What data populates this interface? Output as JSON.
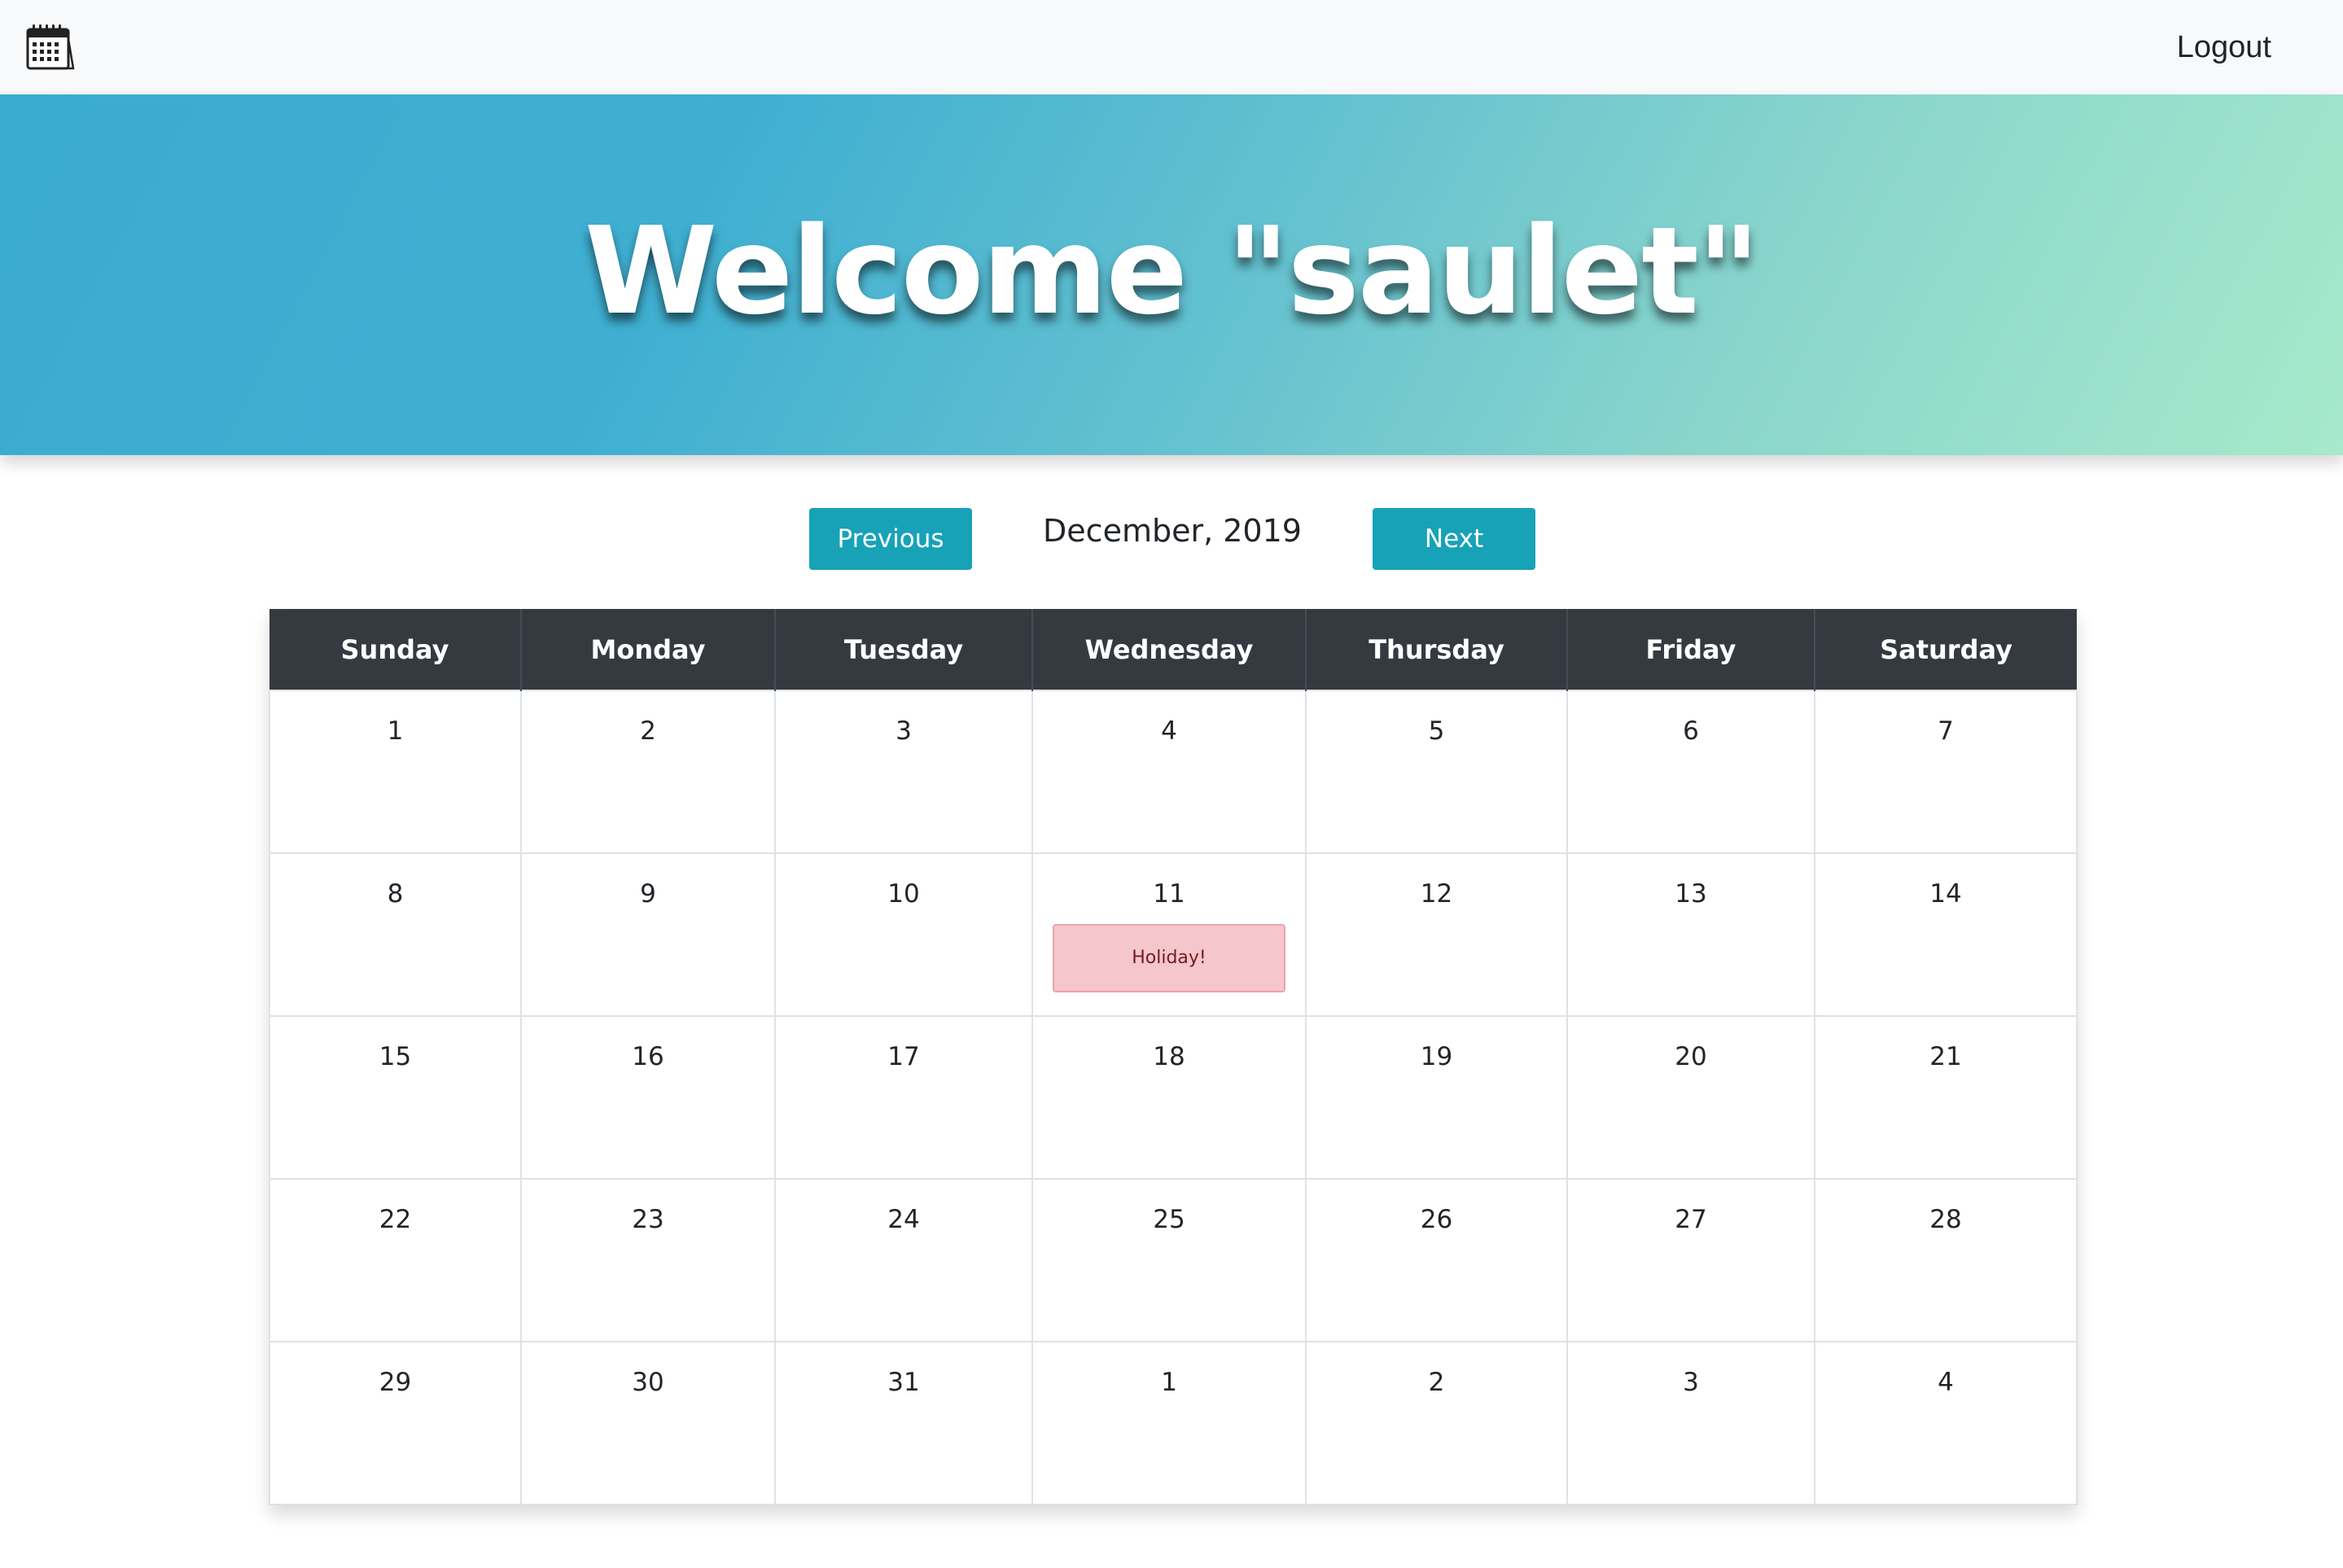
{
  "navbar": {
    "logo_icon": "calendar-icon",
    "logout_label": "Logout"
  },
  "hero": {
    "title": "Welcome \"saulet\""
  },
  "month_nav": {
    "previous_label": "Previous",
    "next_label": "Next",
    "current_month": "December, 2019"
  },
  "calendar": {
    "weekdays": [
      "Sunday",
      "Monday",
      "Tuesday",
      "Wednesday",
      "Thursday",
      "Friday",
      "Saturday"
    ],
    "weeks": [
      [
        {
          "day": "1"
        },
        {
          "day": "2"
        },
        {
          "day": "3"
        },
        {
          "day": "4"
        },
        {
          "day": "5"
        },
        {
          "day": "6"
        },
        {
          "day": "7"
        }
      ],
      [
        {
          "day": "8"
        },
        {
          "day": "9"
        },
        {
          "day": "10"
        },
        {
          "day": "11",
          "event": "Holiday!"
        },
        {
          "day": "12"
        },
        {
          "day": "13"
        },
        {
          "day": "14"
        }
      ],
      [
        {
          "day": "15"
        },
        {
          "day": "16"
        },
        {
          "day": "17"
        },
        {
          "day": "18"
        },
        {
          "day": "19"
        },
        {
          "day": "20"
        },
        {
          "day": "21"
        }
      ],
      [
        {
          "day": "22"
        },
        {
          "day": "23"
        },
        {
          "day": "24"
        },
        {
          "day": "25"
        },
        {
          "day": "26"
        },
        {
          "day": "27"
        },
        {
          "day": "28"
        }
      ],
      [
        {
          "day": "29"
        },
        {
          "day": "30"
        },
        {
          "day": "31"
        },
        {
          "day": "1"
        },
        {
          "day": "2"
        },
        {
          "day": "3"
        },
        {
          "day": "4"
        }
      ]
    ]
  },
  "colors": {
    "accent": "#17a2b8",
    "header_dark": "#343a40",
    "event_bg": "#f5c6cb",
    "event_text": "#721c24"
  }
}
